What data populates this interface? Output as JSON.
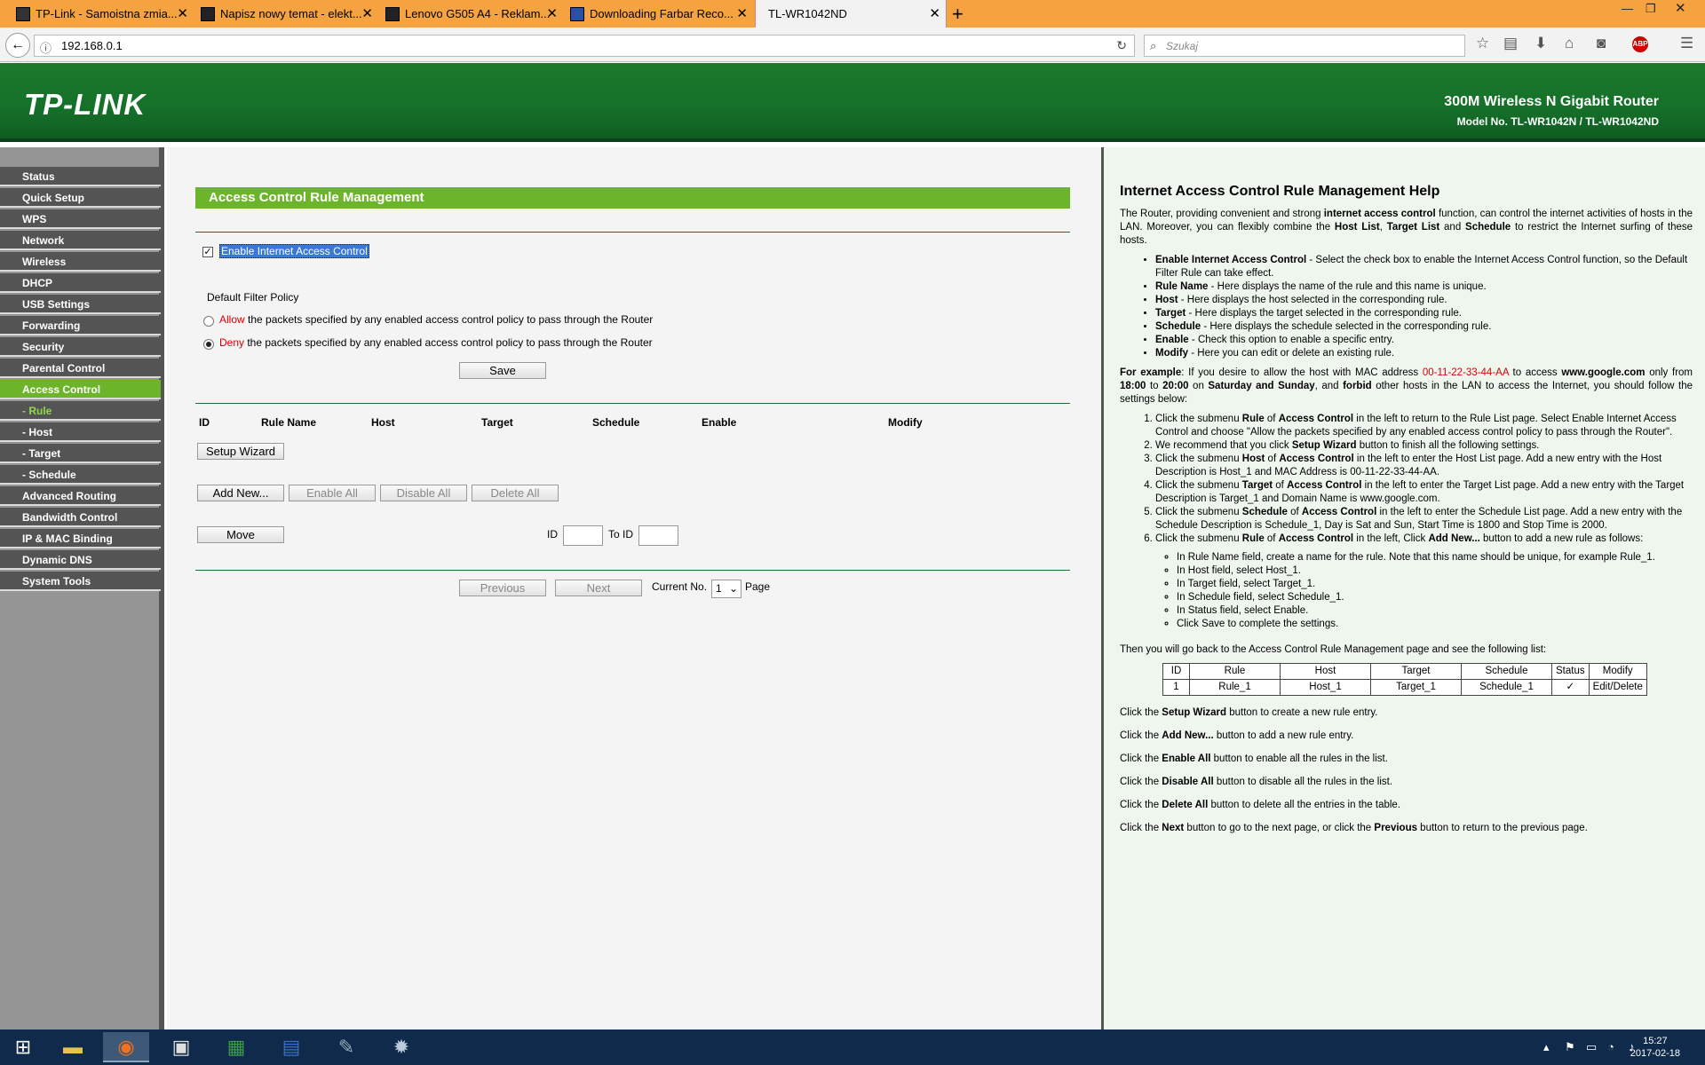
{
  "browser": {
    "tabs": [
      {
        "title": "TP-Link - Samoistna zmia...",
        "active": false
      },
      {
        "title": "Napisz nowy temat - elekt...",
        "active": false
      },
      {
        "title": "Lenovo G505 A4 - Reklam...",
        "active": false
      },
      {
        "title": "Downloading Farbar Reco...",
        "active": false
      },
      {
        "title": "TL-WR1042ND",
        "active": true
      }
    ],
    "url": "192.168.0.1",
    "search_placeholder": "Szukaj"
  },
  "router": {
    "logo": "TP-LINK",
    "product": "300M Wireless N Gigabit Router",
    "model": "Model No. TL-WR1042N / TL-WR1042ND"
  },
  "sidebar": {
    "items": [
      {
        "label": "Status"
      },
      {
        "label": "Quick Setup"
      },
      {
        "label": "WPS"
      },
      {
        "label": "Network"
      },
      {
        "label": "Wireless"
      },
      {
        "label": "DHCP"
      },
      {
        "label": "USB Settings"
      },
      {
        "label": "Forwarding"
      },
      {
        "label": "Security"
      },
      {
        "label": "Parental Control"
      },
      {
        "label": "Access Control",
        "selected": true
      },
      {
        "label": "- Rule",
        "sub": true,
        "current": true
      },
      {
        "label": "- Host",
        "sub": true
      },
      {
        "label": "- Target",
        "sub": true
      },
      {
        "label": "- Schedule",
        "sub": true
      },
      {
        "label": "Advanced Routing"
      },
      {
        "label": "Bandwidth Control"
      },
      {
        "label": "IP & MAC Binding"
      },
      {
        "label": "Dynamic DNS"
      },
      {
        "label": "System Tools"
      }
    ]
  },
  "main": {
    "title": "Access Control Rule Management",
    "enable_label": "Enable Internet Access Control",
    "enable_checked": true,
    "policy_title": "Default Filter Policy",
    "allow_word": "Allow",
    "allow_rest": " the packets specified by any enabled access control policy to pass through the Router",
    "deny_word": "Deny",
    "deny_rest": " the packets specified by any enabled access control policy to pass through the Router",
    "policy_selected": "deny",
    "save": "Save",
    "columns": [
      "ID",
      "Rule Name",
      "Host",
      "Target",
      "Schedule",
      "Enable",
      "Modify"
    ],
    "setup_wizard": "Setup Wizard",
    "add_new": "Add New...",
    "enable_all": "Enable All",
    "disable_all": "Disable All",
    "delete_all": "Delete All",
    "move": "Move",
    "id_label": "ID",
    "to_id_label": "To ID",
    "previous": "Previous",
    "next": "Next",
    "current_no": "Current No.",
    "page_value": "1",
    "page_label": "Page"
  },
  "help": {
    "title": "Internet Access Control Rule Management Help",
    "example_mac": "00-11-22-33-44-AA",
    "table_headers": [
      "ID",
      "Rule",
      "Host",
      "Target",
      "Schedule",
      "Status",
      "Modify"
    ],
    "table_row": [
      "1",
      "Rule_1",
      "Host_1",
      "Target_1",
      "Schedule_1",
      "✓",
      "Edit/Delete"
    ]
  },
  "taskbar": {
    "time": "15:27",
    "date": "2017-02-18"
  }
}
